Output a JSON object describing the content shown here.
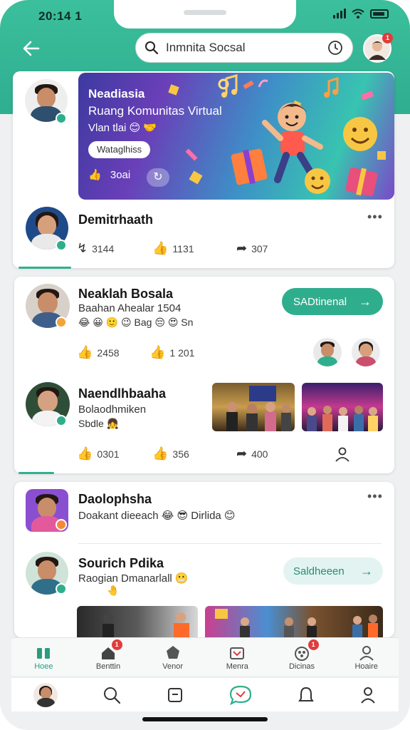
{
  "status_bar": {
    "time": "20:14 1"
  },
  "search": {
    "value": "Inmnita Socsal"
  },
  "badges": {
    "profile": "1",
    "tab_news": "1",
    "tab_discussions": "1"
  },
  "banner": {
    "title": "Neadiasia",
    "subtitle": "Ruang Komunitas Virtual",
    "tagline": "Vlan tlai 😊 🤝",
    "chip": "Wataglhiss",
    "like_count": "3oai"
  },
  "post1": {
    "name": "Demitrhaath",
    "stats": {
      "views": "3144",
      "likes": "1131",
      "shares": "307"
    }
  },
  "post2": {
    "name": "Neaklah Bosala",
    "line1": "Baahan Ahealar 1504",
    "line2": "😂 😀 🙂 😉 Bag 😔 😍 Sn",
    "button": "SADtinenal",
    "stats": {
      "views": "2458",
      "likes": "1 201"
    }
  },
  "post3": {
    "name": "Naendlhbaaha",
    "line1": "Bolaodhmiken",
    "line2": "Sbdle 👧",
    "stats": {
      "views": "0301",
      "likes": "356",
      "shares": "400"
    }
  },
  "post4": {
    "name": "Daolophsha",
    "line1": "Doakant dieeach 😂 😎 Dirlida 😊"
  },
  "post5": {
    "name": "Sourich Pdika",
    "line1": "Raogian Dmanarlall 😬",
    "line2": "🤚",
    "button": "Saldheeen"
  },
  "tabbar": {
    "items": [
      {
        "label": "Hoee",
        "icon": "home-icon"
      },
      {
        "label": "Benttin",
        "icon": "news-icon"
      },
      {
        "label": "Venor",
        "icon": "explore-icon"
      },
      {
        "label": "Menra",
        "icon": "media-icon"
      },
      {
        "label": "Dicinas",
        "icon": "groups-icon"
      },
      {
        "label": "Hoaire",
        "icon": "profile-icon"
      }
    ]
  },
  "colors": {
    "accent": "#2fae8d",
    "header": "#3bbf9c",
    "badge": "#e23b3b"
  }
}
